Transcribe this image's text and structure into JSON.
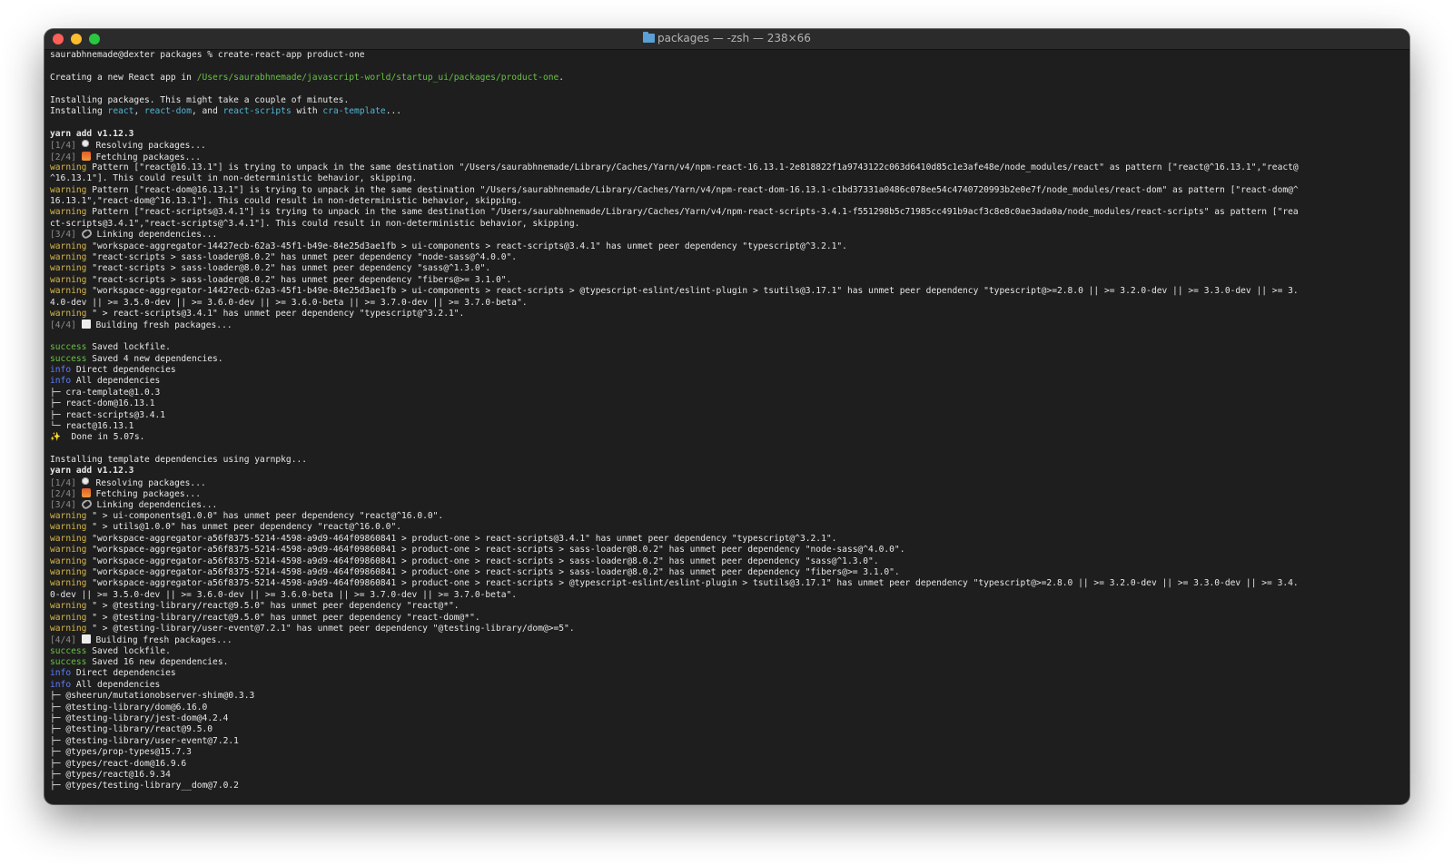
{
  "window": {
    "title": "packages — -zsh — 238×66"
  },
  "terminal": {
    "prompt": "saurabhnemade@dexter packages % create-react-app product-one",
    "creating_prefix": "Creating a new React app in ",
    "creating_path": "/Users/saurabhnemade/javascript-world/startup_ui/packages/product-one",
    "creating_suffix": ".",
    "installing_note": "Installing packages. This might take a couple of minutes.",
    "installing_prefix": "Installing ",
    "pkg_react": "react",
    "comma_sep": ", ",
    "pkg_react_dom": "react-dom",
    "and_sep": ", and ",
    "pkg_react_scripts": "react-scripts",
    "with_sep": " with ",
    "pkg_cra_template": "cra-template",
    "ellipsis": "...",
    "yarn1": "yarn add v1.12.3",
    "s1_1_tag": "[1/4]",
    "s1_1_text": " Resolving packages...",
    "s1_2_tag": "[2/4]",
    "s1_2_text": " Fetching packages...",
    "w1_tag": "warning",
    "w1_text": " Pattern [\"react@16.13.1\"] is trying to unpack in the same destination \"/Users/saurabhnemade/Library/Caches/Yarn/v4/npm-react-16.13.1-2e818822f1a9743122c063d6410d85c1e3afe48e/node_modules/react\" as pattern [\"react@^16.13.1\",\"react@",
    "w1_cont": "^16.13.1\"]. This could result in non-deterministic behavior, skipping.",
    "w2_tag": "warning",
    "w2_text": " Pattern [\"react-dom@16.13.1\"] is trying to unpack in the same destination \"/Users/saurabhnemade/Library/Caches/Yarn/v4/npm-react-dom-16.13.1-c1bd37331a0486c078ee54c4740720993b2e0e7f/node_modules/react-dom\" as pattern [\"react-dom@^",
    "w2_cont": "16.13.1\",\"react-dom@^16.13.1\"]. This could result in non-deterministic behavior, skipping.",
    "w3_tag": "warning",
    "w3_text": " Pattern [\"react-scripts@3.4.1\"] is trying to unpack in the same destination \"/Users/saurabhnemade/Library/Caches/Yarn/v4/npm-react-scripts-3.4.1-f551298b5c71985cc491b9acf3c8e8c0ae3ada0a/node_modules/react-scripts\" as pattern [\"rea",
    "w3_cont": "ct-scripts@3.4.1\",\"react-scripts@^3.4.1\"]. This could result in non-deterministic behavior, skipping.",
    "s1_3_tag": "[3/4]",
    "s1_3_text": " Linking dependencies...",
    "w4_tag": "warning",
    "w4_text": " \"workspace-aggregator-14427ecb-62a3-45f1-b49e-84e25d3ae1fb > ui-components > react-scripts@3.4.1\" has unmet peer dependency \"typescript@^3.2.1\".",
    "w5_tag": "warning",
    "w5_text": " \"react-scripts > sass-loader@8.0.2\" has unmet peer dependency \"node-sass@^4.0.0\".",
    "w6_tag": "warning",
    "w6_text": " \"react-scripts > sass-loader@8.0.2\" has unmet peer dependency \"sass@^1.3.0\".",
    "w7_tag": "warning",
    "w7_text": " \"react-scripts > sass-loader@8.0.2\" has unmet peer dependency \"fibers@>= 3.1.0\".",
    "w8_tag": "warning",
    "w8_text": " \"workspace-aggregator-14427ecb-62a3-45f1-b49e-84e25d3ae1fb > ui-components > react-scripts > @typescript-eslint/eslint-plugin > tsutils@3.17.1\" has unmet peer dependency \"typescript@>=2.8.0 || >= 3.2.0-dev || >= 3.3.0-dev || >= 3.",
    "w8_cont": "4.0-dev || >= 3.5.0-dev || >= 3.6.0-dev || >= 3.6.0-beta || >= 3.7.0-dev || >= 3.7.0-beta\".",
    "w9_tag": "warning",
    "w9_text": " \" > react-scripts@3.4.1\" has unmet peer dependency \"typescript@^3.2.1\".",
    "s1_4_tag": "[4/4]",
    "s1_4_text": " Building fresh packages...",
    "succ1_tag": "success",
    "succ1_text": " Saved lockfile.",
    "succ2_tag": "success",
    "succ2_text": " Saved 4 new dependencies.",
    "info1_tag": "info",
    "info1_text": " Direct dependencies",
    "info2_tag": "info",
    "info2_text": " All dependencies",
    "dep1": [
      "├─ cra-template@1.0.3",
      "├─ react-dom@16.13.1",
      "├─ react-scripts@3.4.1",
      "└─ react@16.13.1"
    ],
    "done": "  Done in 5.07s.",
    "template_note": "Installing template dependencies using yarnpkg...",
    "yarn2": "yarn add v1.12.3",
    "s2_1_tag": "[1/4]",
    "s2_1_text": " Resolving packages...",
    "s2_2_tag": "[2/4]",
    "s2_2_text": " Fetching packages...",
    "s2_3_tag": "[3/4]",
    "s2_3_text": " Linking dependencies...",
    "x1_tag": "warning",
    "x1_text": " \" > ui-components@1.0.0\" has unmet peer dependency \"react@^16.0.0\".",
    "x2_tag": "warning",
    "x2_text": " \" > utils@1.0.0\" has unmet peer dependency \"react@^16.0.0\".",
    "x3_tag": "warning",
    "x3_text": " \"workspace-aggregator-a56f8375-5214-4598-a9d9-464f09860841 > product-one > react-scripts@3.4.1\" has unmet peer dependency \"typescript@^3.2.1\".",
    "x4_tag": "warning",
    "x4_text": " \"workspace-aggregator-a56f8375-5214-4598-a9d9-464f09860841 > product-one > react-scripts > sass-loader@8.0.2\" has unmet peer dependency \"node-sass@^4.0.0\".",
    "x5_tag": "warning",
    "x5_text": " \"workspace-aggregator-a56f8375-5214-4598-a9d9-464f09860841 > product-one > react-scripts > sass-loader@8.0.2\" has unmet peer dependency \"sass@^1.3.0\".",
    "x6_tag": "warning",
    "x6_text": " \"workspace-aggregator-a56f8375-5214-4598-a9d9-464f09860841 > product-one > react-scripts > sass-loader@8.0.2\" has unmet peer dependency \"fibers@>= 3.1.0\".",
    "x7_tag": "warning",
    "x7_text": " \"workspace-aggregator-a56f8375-5214-4598-a9d9-464f09860841 > product-one > react-scripts > @typescript-eslint/eslint-plugin > tsutils@3.17.1\" has unmet peer dependency \"typescript@>=2.8.0 || >= 3.2.0-dev || >= 3.3.0-dev || >= 3.4.",
    "x7_cont": "0-dev || >= 3.5.0-dev || >= 3.6.0-dev || >= 3.6.0-beta || >= 3.7.0-dev || >= 3.7.0-beta\".",
    "x8_tag": "warning",
    "x8_text": " \" > @testing-library/react@9.5.0\" has unmet peer dependency \"react@*\".",
    "x9_tag": "warning",
    "x9_text": " \" > @testing-library/react@9.5.0\" has unmet peer dependency \"react-dom@*\".",
    "x10_tag": "warning",
    "x10_text": " \" > @testing-library/user-event@7.2.1\" has unmet peer dependency \"@testing-library/dom@>=5\".",
    "s2_4_tag": "[4/4]",
    "s2_4_text": " Building fresh packages...",
    "succ3_tag": "success",
    "succ3_text": " Saved lockfile.",
    "succ4_tag": "success",
    "succ4_text": " Saved 16 new dependencies.",
    "info3_tag": "info",
    "info3_text": " Direct dependencies",
    "info4_tag": "info",
    "info4_text": " All dependencies",
    "dep2": [
      "├─ @sheerun/mutationobserver-shim@0.3.3",
      "├─ @testing-library/dom@6.16.0",
      "├─ @testing-library/jest-dom@4.2.4",
      "├─ @testing-library/react@9.5.0",
      "├─ @testing-library/user-event@7.2.1",
      "├─ @types/prop-types@15.7.3",
      "├─ @types/react-dom@16.9.6",
      "├─ @types/react@16.9.34",
      "├─ @types/testing-library__dom@7.0.2"
    ]
  }
}
